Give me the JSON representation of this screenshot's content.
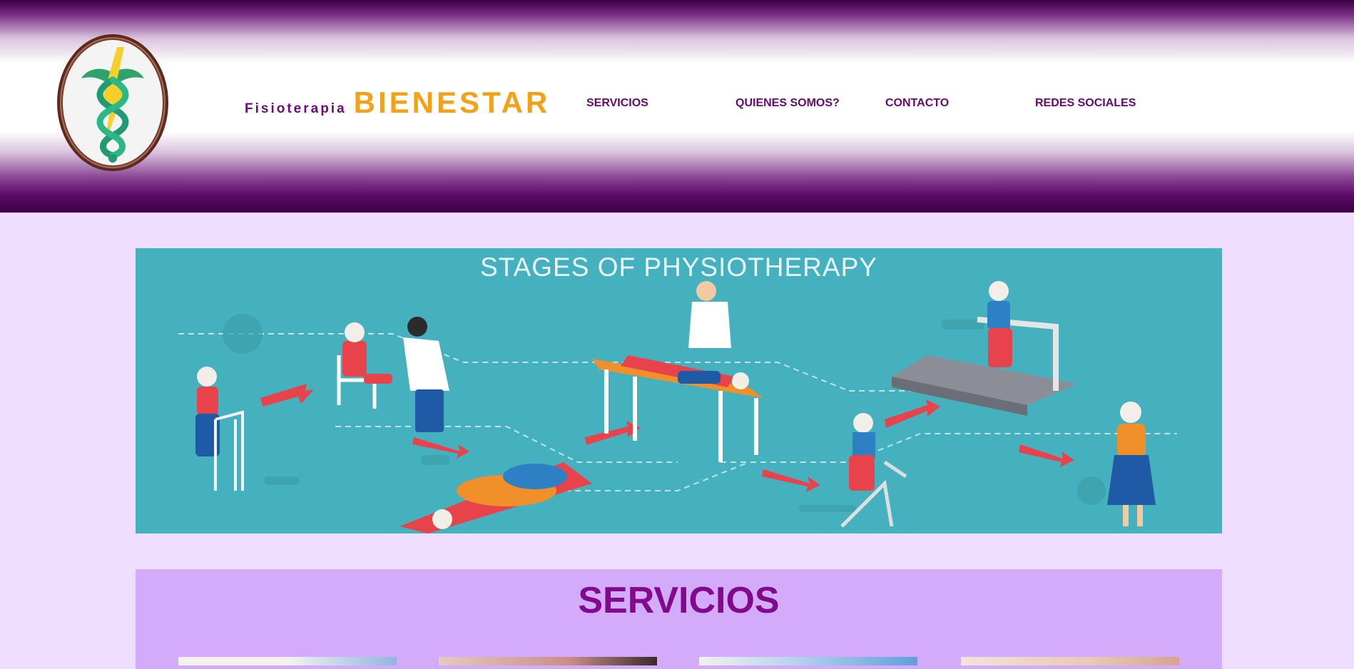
{
  "header": {
    "brand_small": "Fisioterapia",
    "brand_big": "BIENESTAR",
    "nav": [
      {
        "label": "SERVICIOS"
      },
      {
        "label": "QUIENES SOMOS?"
      },
      {
        "label": "CONTACTO"
      },
      {
        "label": "REDES SOCIALES"
      }
    ],
    "logo_icon": "caduceus-lightning-icon"
  },
  "hero": {
    "title": "STAGES OF PHYSIOTHERAPY"
  },
  "services": {
    "title": "SERVICIOS"
  },
  "colors": {
    "header_purple": "#3e0047",
    "brand_orange": "#f5a116",
    "nav_text": "#650973",
    "page_bg": "#efdeff",
    "services_bg": "#d3abfb",
    "services_title": "#82088c",
    "hero_bg": "#45b1be"
  }
}
